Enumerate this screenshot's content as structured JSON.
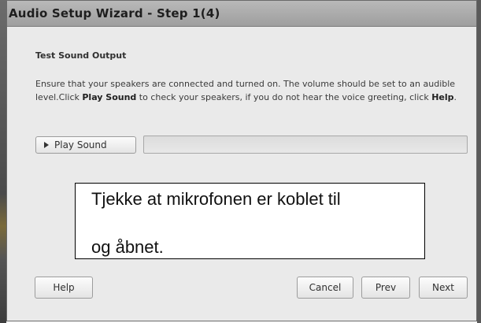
{
  "window": {
    "title": "Audio Setup Wizard - Step 1(4)"
  },
  "section": {
    "heading": "Test Sound Output",
    "description_before_play": "Ensure that your speakers are connected and turned on. The volume should be set to an audible level.Click ",
    "description_play_bold": "Play Sound",
    "description_after_play": " to check your speakers, if you do not hear the voice greeting, click ",
    "description_help_bold": "Help",
    "description_end": "."
  },
  "play": {
    "label": "Play Sound",
    "icon": "play-triangle-icon",
    "progress": 0
  },
  "overlay_note": {
    "line1": "Tjekke at mikrofonen er koblet til",
    "line2": "og åbnet."
  },
  "footer": {
    "help_label": "Help",
    "cancel_label": "Cancel",
    "prev_label": "Prev",
    "next_label": "Next"
  },
  "colors": {
    "titlebar": "#a9a9a9",
    "window_bg": "#eaeaea",
    "progress_fill": "#7fb34a"
  }
}
